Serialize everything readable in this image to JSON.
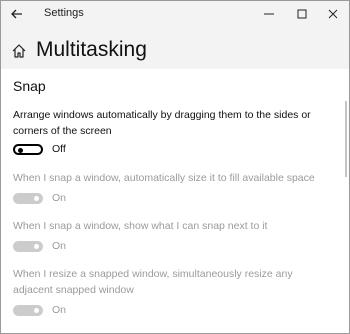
{
  "window": {
    "title": "Settings",
    "controls": {
      "back_icon": "arrow-left-icon",
      "minimize_icon": "minimize-icon",
      "maximize_icon": "maximize-icon",
      "close_icon": "close-icon"
    }
  },
  "header": {
    "home_icon": "home-icon",
    "title": "Multitasking"
  },
  "snap": {
    "section_title": "Snap",
    "settings": [
      {
        "description": "Arrange windows automatically by dragging them to the sides or corners of the screen",
        "state_label": "Off",
        "on": false,
        "disabled": false
      },
      {
        "description": "When I snap a window, automatically size it to fill available space",
        "state_label": "On",
        "on": true,
        "disabled": true
      },
      {
        "description": "When I snap a window, show what I can snap next to it",
        "state_label": "On",
        "on": true,
        "disabled": true
      },
      {
        "description": "When I resize a snapped window, simultaneously resize any adjacent snapped window",
        "state_label": "On",
        "on": true,
        "disabled": true
      }
    ]
  },
  "colors": {
    "titlebar_bg": "#f3f3f3",
    "disabled_text": "#9b9b9b",
    "toggle_disabled": "#cccccc"
  }
}
